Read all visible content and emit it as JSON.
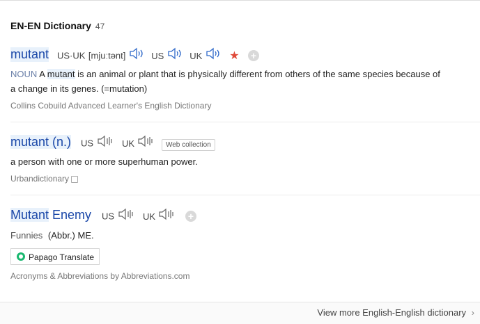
{
  "header": {
    "title": "EN-EN Dictionary",
    "count": "47"
  },
  "entries": [
    {
      "headword": "mutant",
      "us_uk_label": "US·UK",
      "pronunciation": "[mjuːtənt]",
      "us_label": "US",
      "uk_label": "UK",
      "pos": "NOUN",
      "def_pre": "A ",
      "def_highlight": "mutant",
      "def_line1_rest": " is an animal or plant that is physically different from others of the same species because of",
      "def_line2": "a change in its genes. (=mutation)",
      "source": "Collins Cobuild Advanced Learner's English Dictionary"
    },
    {
      "headword": "mutant (n.)",
      "us_label": "US",
      "uk_label": "UK",
      "tag": "Web collection",
      "definition": "a person with one or more superhuman power.",
      "source": "Urbandictionary"
    },
    {
      "headword_hl": "Mutant",
      "headword_rest": " Enemy",
      "us_label": "US",
      "uk_label": "UK",
      "category": "Funnies",
      "definition": "(Abbr.) ME.",
      "papago_label": "Papago Translate",
      "source": "Acronyms & Abbreviations by Abbreviations.com"
    }
  ],
  "footer": {
    "more_label": "View more English-English dictionary",
    "arrow": "›"
  },
  "colors": {
    "accent": "#1a47a8",
    "star": "#e04a3a",
    "papago": "#19b86f"
  },
  "icons": [
    "speaker-icon",
    "star-icon",
    "plus-icon",
    "copy-icon",
    "papago-icon",
    "chevron-right-icon"
  ]
}
